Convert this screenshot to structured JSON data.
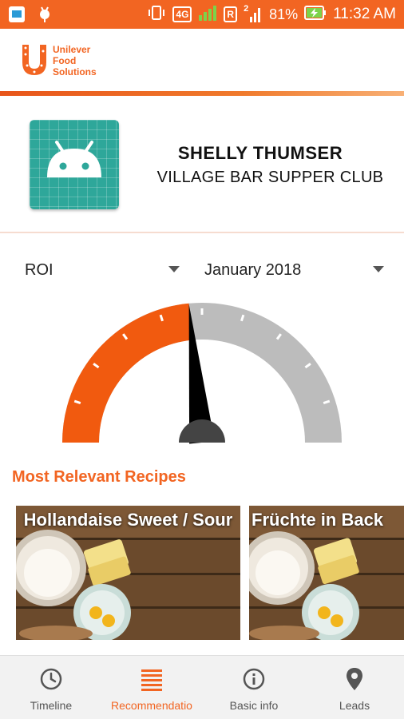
{
  "status_bar": {
    "network": "4G",
    "roaming": "R",
    "sim_slot": "2",
    "battery": "81%",
    "time": "11:32 AM",
    "color": "#f26522"
  },
  "header": {
    "brand_lines": [
      "Unilever",
      "Food",
      "Solutions"
    ],
    "brand_color": "#f26522"
  },
  "profile": {
    "name": "SHELLY THUMSER",
    "business": "VILLAGE BAR SUPPER CLUB",
    "avatar_icon": "android-icon"
  },
  "filters": {
    "metric": "ROI",
    "month": "January 2018"
  },
  "gauge": {
    "value_fraction": 0.47,
    "fill_color": "#f15a0f",
    "track_color": "#bcbcbc",
    "needle_color": "#000000",
    "hub_color": "#444444"
  },
  "recipes": {
    "section_title": "Most Relevant Recipes",
    "items": [
      {
        "title": "Hollandaise Sweet / Sour"
      },
      {
        "title": "Früchte in Back"
      }
    ]
  },
  "bottom_nav": {
    "items": [
      {
        "label": "Timeline",
        "icon": "clock-icon",
        "active": false
      },
      {
        "label": "Recommendatio",
        "icon": "list-icon",
        "active": true
      },
      {
        "label": "Basic info",
        "icon": "info-icon",
        "active": false
      },
      {
        "label": "Leads",
        "icon": "map-pin-icon",
        "active": false
      }
    ],
    "active_color": "#f26522"
  }
}
